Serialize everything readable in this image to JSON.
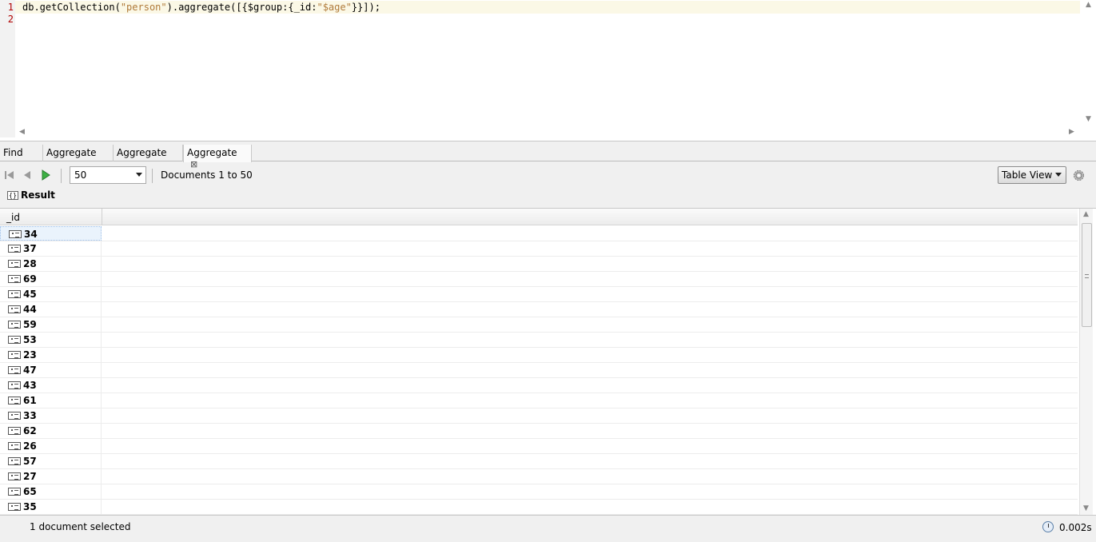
{
  "editor": {
    "lines": [
      "1",
      "2"
    ],
    "code_prefix": "db.getCollection(",
    "code_str1": "\"person\"",
    "code_mid": ").aggregate([{$group:{_id:",
    "code_str2": "\"$age\"",
    "code_suffix": "}}]);"
  },
  "tabs": [
    {
      "label": "Find"
    },
    {
      "label": "Aggregate"
    },
    {
      "label": "Aggregate"
    },
    {
      "label": "Aggregate",
      "active": true
    }
  ],
  "toolbar": {
    "page_size": "50",
    "documents_label": "Documents 1 to 50",
    "view_mode": "Table View"
  },
  "result": {
    "label": "Result",
    "column": "_id",
    "rows": [
      "34",
      "37",
      "28",
      "69",
      "45",
      "44",
      "59",
      "53",
      "23",
      "47",
      "43",
      "61",
      "33",
      "62",
      "26",
      "57",
      "27",
      "65",
      "35"
    ]
  },
  "status": {
    "message": "1 document selected",
    "time": "0.002s"
  },
  "colors": {
    "accent_play": "#3cb043",
    "line_number": "#b00000",
    "string": "#b07a3a"
  }
}
